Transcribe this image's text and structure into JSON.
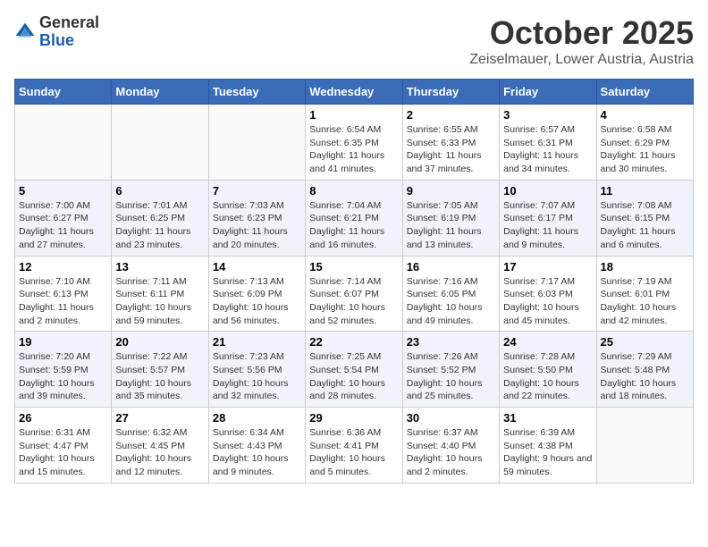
{
  "header": {
    "logo_general": "General",
    "logo_blue": "Blue",
    "month": "October 2025",
    "location": "Zeiselmauer, Lower Austria, Austria"
  },
  "days_of_week": [
    "Sunday",
    "Monday",
    "Tuesday",
    "Wednesday",
    "Thursday",
    "Friday",
    "Saturday"
  ],
  "weeks": [
    [
      {
        "day": "",
        "info": ""
      },
      {
        "day": "",
        "info": ""
      },
      {
        "day": "",
        "info": ""
      },
      {
        "day": "1",
        "info": "Sunrise: 6:54 AM\nSunset: 6:35 PM\nDaylight: 11 hours and 41 minutes."
      },
      {
        "day": "2",
        "info": "Sunrise: 6:55 AM\nSunset: 6:33 PM\nDaylight: 11 hours and 37 minutes."
      },
      {
        "day": "3",
        "info": "Sunrise: 6:57 AM\nSunset: 6:31 PM\nDaylight: 11 hours and 34 minutes."
      },
      {
        "day": "4",
        "info": "Sunrise: 6:58 AM\nSunset: 6:29 PM\nDaylight: 11 hours and 30 minutes."
      }
    ],
    [
      {
        "day": "5",
        "info": "Sunrise: 7:00 AM\nSunset: 6:27 PM\nDaylight: 11 hours and 27 minutes."
      },
      {
        "day": "6",
        "info": "Sunrise: 7:01 AM\nSunset: 6:25 PM\nDaylight: 11 hours and 23 minutes."
      },
      {
        "day": "7",
        "info": "Sunrise: 7:03 AM\nSunset: 6:23 PM\nDaylight: 11 hours and 20 minutes."
      },
      {
        "day": "8",
        "info": "Sunrise: 7:04 AM\nSunset: 6:21 PM\nDaylight: 11 hours and 16 minutes."
      },
      {
        "day": "9",
        "info": "Sunrise: 7:05 AM\nSunset: 6:19 PM\nDaylight: 11 hours and 13 minutes."
      },
      {
        "day": "10",
        "info": "Sunrise: 7:07 AM\nSunset: 6:17 PM\nDaylight: 11 hours and 9 minutes."
      },
      {
        "day": "11",
        "info": "Sunrise: 7:08 AM\nSunset: 6:15 PM\nDaylight: 11 hours and 6 minutes."
      }
    ],
    [
      {
        "day": "12",
        "info": "Sunrise: 7:10 AM\nSunset: 6:13 PM\nDaylight: 11 hours and 2 minutes."
      },
      {
        "day": "13",
        "info": "Sunrise: 7:11 AM\nSunset: 6:11 PM\nDaylight: 10 hours and 59 minutes."
      },
      {
        "day": "14",
        "info": "Sunrise: 7:13 AM\nSunset: 6:09 PM\nDaylight: 10 hours and 56 minutes."
      },
      {
        "day": "15",
        "info": "Sunrise: 7:14 AM\nSunset: 6:07 PM\nDaylight: 10 hours and 52 minutes."
      },
      {
        "day": "16",
        "info": "Sunrise: 7:16 AM\nSunset: 6:05 PM\nDaylight: 10 hours and 49 minutes."
      },
      {
        "day": "17",
        "info": "Sunrise: 7:17 AM\nSunset: 6:03 PM\nDaylight: 10 hours and 45 minutes."
      },
      {
        "day": "18",
        "info": "Sunrise: 7:19 AM\nSunset: 6:01 PM\nDaylight: 10 hours and 42 minutes."
      }
    ],
    [
      {
        "day": "19",
        "info": "Sunrise: 7:20 AM\nSunset: 5:59 PM\nDaylight: 10 hours and 39 minutes."
      },
      {
        "day": "20",
        "info": "Sunrise: 7:22 AM\nSunset: 5:57 PM\nDaylight: 10 hours and 35 minutes."
      },
      {
        "day": "21",
        "info": "Sunrise: 7:23 AM\nSunset: 5:56 PM\nDaylight: 10 hours and 32 minutes."
      },
      {
        "day": "22",
        "info": "Sunrise: 7:25 AM\nSunset: 5:54 PM\nDaylight: 10 hours and 28 minutes."
      },
      {
        "day": "23",
        "info": "Sunrise: 7:26 AM\nSunset: 5:52 PM\nDaylight: 10 hours and 25 minutes."
      },
      {
        "day": "24",
        "info": "Sunrise: 7:28 AM\nSunset: 5:50 PM\nDaylight: 10 hours and 22 minutes."
      },
      {
        "day": "25",
        "info": "Sunrise: 7:29 AM\nSunset: 5:48 PM\nDaylight: 10 hours and 18 minutes."
      }
    ],
    [
      {
        "day": "26",
        "info": "Sunrise: 6:31 AM\nSunset: 4:47 PM\nDaylight: 10 hours and 15 minutes."
      },
      {
        "day": "27",
        "info": "Sunrise: 6:32 AM\nSunset: 4:45 PM\nDaylight: 10 hours and 12 minutes."
      },
      {
        "day": "28",
        "info": "Sunrise: 6:34 AM\nSunset: 4:43 PM\nDaylight: 10 hours and 9 minutes."
      },
      {
        "day": "29",
        "info": "Sunrise: 6:36 AM\nSunset: 4:41 PM\nDaylight: 10 hours and 5 minutes."
      },
      {
        "day": "30",
        "info": "Sunrise: 6:37 AM\nSunset: 4:40 PM\nDaylight: 10 hours and 2 minutes."
      },
      {
        "day": "31",
        "info": "Sunrise: 6:39 AM\nSunset: 4:38 PM\nDaylight: 9 hours and 59 minutes."
      },
      {
        "day": "",
        "info": ""
      }
    ]
  ]
}
